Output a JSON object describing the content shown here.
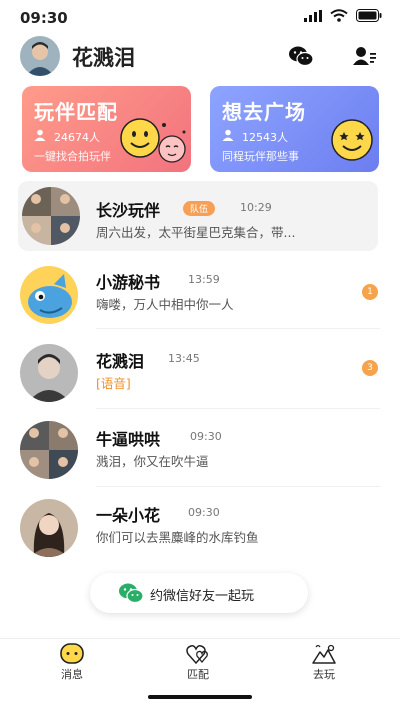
{
  "status_bar": {
    "time": "09:30"
  },
  "header": {
    "user_name": "花溅泪"
  },
  "cards": [
    {
      "title": "玩伴匹配",
      "count": "24674人",
      "subtitle": "一键找合拍玩伴"
    },
    {
      "title": "想去广场",
      "count": "12543人",
      "subtitle": "同程玩伴那些事"
    }
  ],
  "chats": [
    {
      "name": "长沙玩伴",
      "tag": "队伍",
      "time": "10:29",
      "message": "周六出发，太平街星巴克集合，带..."
    },
    {
      "name": "小游秘书",
      "time": "13:59",
      "message": "嗨喽，万人中相中你一人",
      "badge": "1"
    },
    {
      "name": "花溅泪",
      "time": "13:45",
      "message": "[语音]",
      "badge": "3"
    },
    {
      "name": "牛逼哄哄",
      "time": "09:30",
      "message": "溅泪，你又在吹牛逼"
    },
    {
      "name": "一朵小花",
      "time": "09:30",
      "message": "你们可以去黑麋峰的水库钓鱼"
    }
  ],
  "invite": {
    "label": "约微信好友一起玩"
  },
  "tabs": [
    {
      "label": "消息"
    },
    {
      "label": "匹配"
    },
    {
      "label": "去玩"
    }
  ],
  "colors": {
    "accent": "#f7a34b",
    "card_left": "#f2737e",
    "card_right": "#6c7ef0",
    "wechat": "#2aae67"
  }
}
